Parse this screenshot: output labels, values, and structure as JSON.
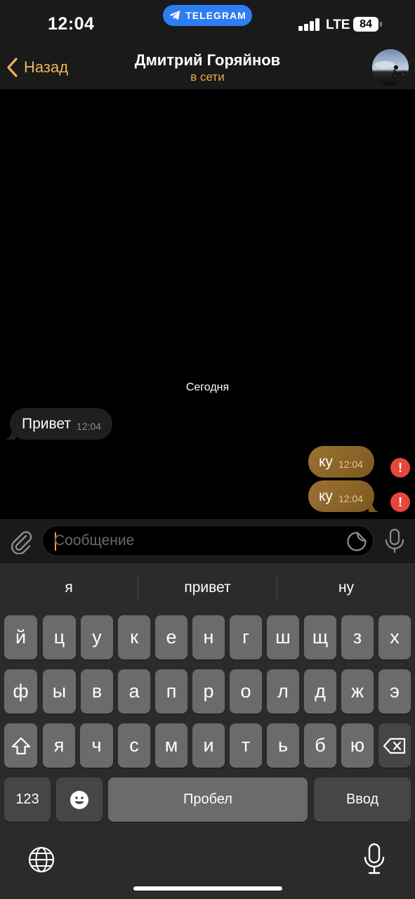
{
  "status_bar": {
    "time": "12:04",
    "app_pill_label": "TELEGRAM",
    "network": "LTE",
    "battery": "84"
  },
  "header": {
    "back_label": "Назад",
    "contact_name": "Дмитрий Горяйнов",
    "contact_status": "в сети"
  },
  "chat": {
    "date_label": "Сегодня",
    "messages": [
      {
        "direction": "in",
        "text": "Привет",
        "time": "12:04"
      },
      {
        "direction": "out",
        "text": "ку",
        "time": "12:04",
        "failed": true
      },
      {
        "direction": "out",
        "text": "ку",
        "time": "12:04",
        "failed": true
      }
    ],
    "error_mark": "!"
  },
  "composer": {
    "placeholder": "Сообщение"
  },
  "keyboard": {
    "suggestions": [
      "я",
      "привет",
      "ну"
    ],
    "row1": [
      "й",
      "ц",
      "у",
      "к",
      "е",
      "н",
      "г",
      "ш",
      "щ",
      "з",
      "х"
    ],
    "row2": [
      "ф",
      "ы",
      "в",
      "а",
      "п",
      "р",
      "о",
      "л",
      "д",
      "ж",
      "э"
    ],
    "row3": [
      "я",
      "ч",
      "с",
      "м",
      "и",
      "т",
      "ь",
      "б",
      "ю"
    ],
    "numbers_label": "123",
    "space_label": "Пробел",
    "return_label": "Ввод"
  },
  "colors": {
    "accent": "#f0a847",
    "outgoing_bubble": "#8a6428",
    "incoming_bubble": "#1f1f1f",
    "error": "#e5473c",
    "telegram_blue": "#2c7ef2"
  }
}
